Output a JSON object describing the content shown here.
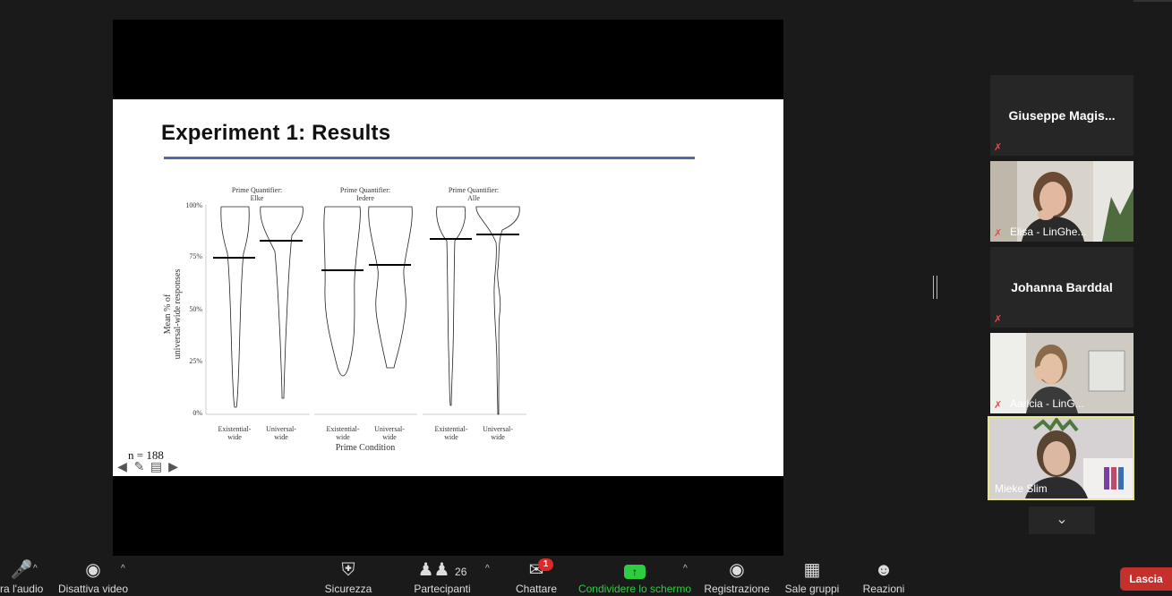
{
  "slide": {
    "title": "Experiment 1: Results",
    "n_label": "n = 188",
    "chart_data": {
      "type": "violin",
      "ylabel": "Mean % of universal-wide responses",
      "ylabel_line1": "Mean % of",
      "ylabel_line2": "universal-wide responses",
      "xlabel": "Prime Condition",
      "yticks": [
        "100%",
        "75%",
        "50%",
        "25%",
        "0%"
      ],
      "panels": [
        {
          "title_line1": "Prime Quantifier:",
          "title_line2": "Elke",
          "groups": [
            {
              "label_line1": "Existential-",
              "label_line2": "wide",
              "mean": 75
            },
            {
              "label_line1": "Universal-",
              "label_line2": "wide",
              "mean": 83
            }
          ]
        },
        {
          "title_line1": "Prime Quantifier:",
          "title_line2": "Iedere",
          "groups": [
            {
              "label_line1": "Existential-",
              "label_line2": "wide",
              "mean": 69
            },
            {
              "label_line1": "Universal-",
              "label_line2": "wide",
              "mean": 72
            }
          ]
        },
        {
          "title_line1": "Prime Quantifier:",
          "title_line2": "Alle",
          "groups": [
            {
              "label_line1": "Existential-",
              "label_line2": "wide",
              "mean": 84
            },
            {
              "label_line1": "Universal-",
              "label_line2": "wide",
              "mean": 86
            }
          ]
        }
      ]
    }
  },
  "participants": [
    {
      "name": "Giuseppe  Magis...",
      "video": false
    },
    {
      "name": "Elisa - LinGhe...",
      "video": true
    },
    {
      "name": "Johanna Barddal",
      "video": false
    },
    {
      "name": "Aaricia - LinG...",
      "video": true
    },
    {
      "name": "Mieke Slim",
      "video": true,
      "active_speaker": true
    }
  ],
  "toolbar": {
    "mute_label": "ra l'audio",
    "video_label": "Disattiva video",
    "security_label": "Sicurezza",
    "participants_label": "Partecipanti",
    "participants_count": "26",
    "chat_label": "Chattare",
    "chat_badge": "1",
    "share_label": "Condividere lo schermo",
    "record_label": "Registrazione",
    "breakout_label": "Sale gruppi",
    "reactions_label": "Reazioni",
    "leave_label": "Lascia"
  },
  "colors": {
    "share_green": "#2ecc40",
    "leave_red": "#c4302b",
    "speaker_border": "#e8e88a",
    "title_rule": "#4e6aa8"
  }
}
